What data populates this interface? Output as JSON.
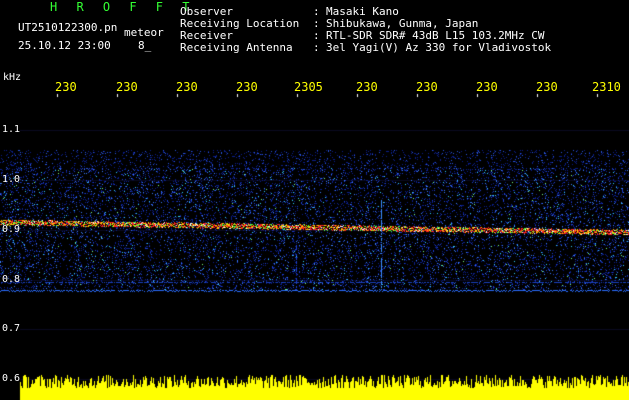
{
  "header": {
    "app_title": "H R O F F T",
    "filename": "UT2510122300.pn",
    "mode_label": "meteor",
    "datetime": "25.10.12 23:00",
    "count": "8_",
    "rows": [
      {
        "label": "Observer",
        "colon": ":",
        "value": "Masaki Kano"
      },
      {
        "label": "Receiving Location",
        "colon": ":",
        "value": "Shibukawa, Gunma, Japan"
      },
      {
        "label": "Receiver",
        "colon": ":",
        "value": "RTL-SDR SDR# 43dB L15 103.2MHz CW"
      },
      {
        "label": "Receiving Antenna",
        "colon": ":",
        "value": "3el Yagi(V) Az 330 for Vladivostok"
      }
    ]
  },
  "y_axis": {
    "unit": "kHz",
    "ticks": [
      "1.1",
      "1.0",
      "0.9",
      "0.8",
      "0.7",
      "0.6"
    ]
  },
  "x_axis": {
    "ticks": [
      "230",
      "230",
      "230",
      "230",
      "2305",
      "230",
      "230",
      "230",
      "230",
      "2310"
    ]
  },
  "colors": {
    "background": "#000000",
    "noise": "#0a2a9a",
    "echo_trace": "#ff2020",
    "noise_bar": "#ffff00",
    "title": "#33ff33"
  }
}
